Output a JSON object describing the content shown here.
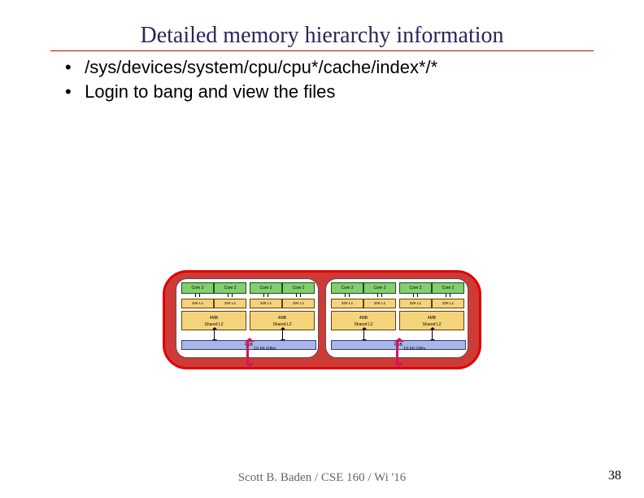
{
  "title": "Detailed memory hierarchy  information",
  "bullets": [
    "/sys/devices/system/cpu/cpu*/cache/index*/*",
    "Login to bang and view the files"
  ],
  "diagram": {
    "core_label": "Core 2",
    "l1_label": "32K L1",
    "l2_label_line1": "4MB",
    "l2_label_line2": "Shared L2",
    "fsb_label": "FSB",
    "bw_label": "10.66 GB/s"
  },
  "footer": "Scott B. Baden / CSE 160 / Wi '16",
  "page_number": "38"
}
